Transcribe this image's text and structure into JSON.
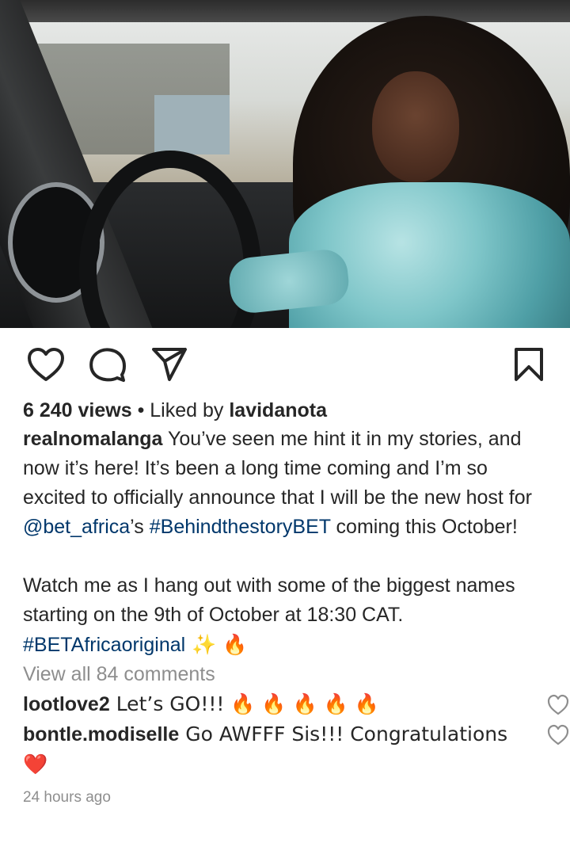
{
  "post": {
    "image_alt": "Woman in sequined teal dress sitting in driver seat of car",
    "views_count": "6 240 views",
    "separator": " • ",
    "liked_by_prefix": "Liked by ",
    "liked_by_user": "lavidanota",
    "author": "realnomalanga",
    "caption_part1": " You’ve seen me hint it in my stories, and now it’s here! It’s been a long time coming and I’m so excited to officially announce that I will be the new host for ",
    "caption_mention": "@bet_africa",
    "caption_part2": "’s ",
    "caption_hashtag1": "#BehindthestoryBET",
    "caption_part3": " coming this October!\n\nWatch me as I hang out with some of the biggest names starting on the 9th of October at 18:30 CAT. ",
    "caption_hashtag2": "#BETAfricaoriginal",
    "caption_emoji": " ✨ 🔥",
    "view_all_comments": "View all 84 comments",
    "timestamp": "24 hours ago"
  },
  "comments": [
    {
      "user": "lootlove2",
      "text": " Let’s GO!!! 🔥 🔥 🔥 🔥 🔥"
    },
    {
      "user": "bontle.modiselle",
      "text": " Go AWFFF Sis!!! Congratulations ❤️"
    }
  ],
  "colors": {
    "text": "#262626",
    "link": "#00376b",
    "muted": "#8e8e8e",
    "icon": "#262626"
  },
  "icons": {
    "like": "heart-outline-icon",
    "comment": "comment-bubble-icon",
    "share": "paper-plane-icon",
    "save": "bookmark-icon"
  }
}
